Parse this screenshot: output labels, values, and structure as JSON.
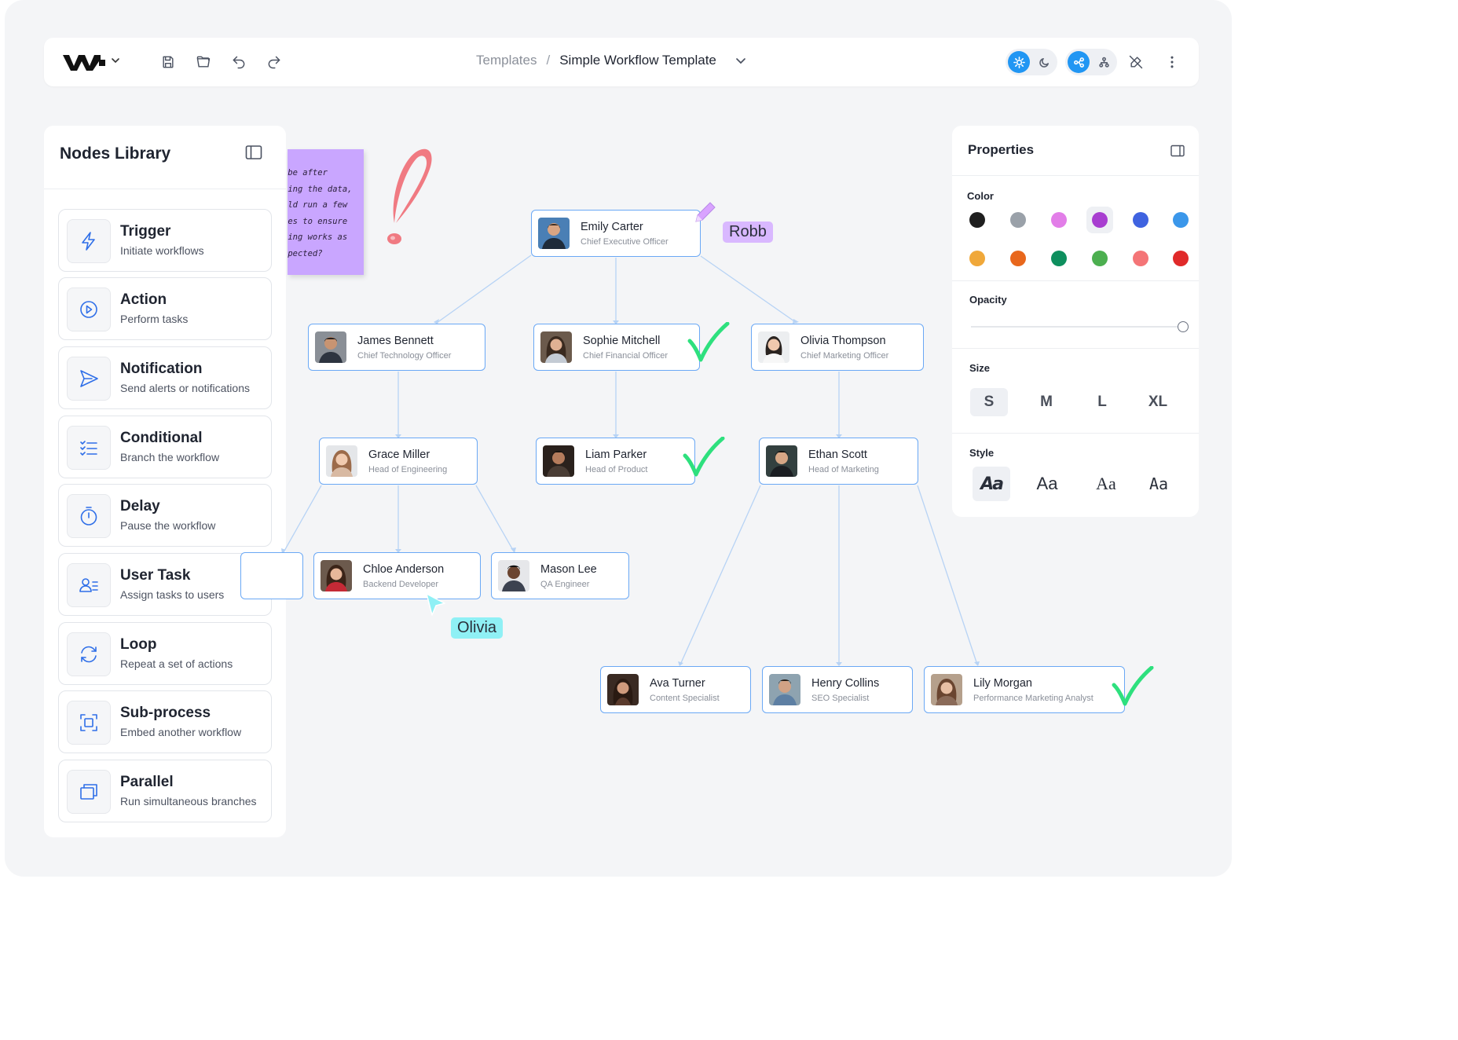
{
  "header": {
    "breadcrumb_parent": "Templates",
    "breadcrumb_separator": "/",
    "breadcrumb_current": "Simple Workflow Template",
    "toolbar_icons": [
      "save-icon",
      "folder-open-icon",
      "undo-icon",
      "redo-icon"
    ],
    "right_icons": [
      "sun-icon",
      "moon-icon",
      "workflow-view-icon",
      "hierarchy-view-icon",
      "edit-off-icon",
      "more-vertical-icon"
    ],
    "accent_color": "#2196f3"
  },
  "nodes_library": {
    "title": "Nodes Library",
    "items": [
      {
        "title": "Trigger",
        "subtitle": "Initiate workflows",
        "icon": "lightning-icon"
      },
      {
        "title": "Action",
        "subtitle": "Perform tasks",
        "icon": "play-circle-icon"
      },
      {
        "title": "Notification",
        "subtitle": "Send alerts or notifications",
        "icon": "send-icon"
      },
      {
        "title": "Conditional",
        "subtitle": "Branch the workflow",
        "icon": "checklist-icon"
      },
      {
        "title": "Delay",
        "subtitle": "Pause the workflow",
        "icon": "timer-icon"
      },
      {
        "title": "User Task",
        "subtitle": "Assign tasks to users",
        "icon": "user-list-icon"
      },
      {
        "title": "Loop",
        "subtitle": "Repeat a set of actions",
        "icon": "loop-icon"
      },
      {
        "title": "Sub-process",
        "subtitle": "Embed another workflow",
        "icon": "subprocess-icon"
      },
      {
        "title": "Parallel",
        "subtitle": "Run simultaneous branches",
        "icon": "parallel-icon"
      }
    ]
  },
  "canvas": {
    "sticky_note_lines": [
      "ybe after",
      "sing the data,",
      "uld run a few",
      "ses to ensure",
      "hing works as",
      "xpected?"
    ],
    "sticky_color": "#c9a6ff",
    "cursor_labels": {
      "robb": "Robb",
      "olivia": "Olivia"
    },
    "people": [
      {
        "name": "Emily Carter",
        "role": "Chief Executive Officer"
      },
      {
        "name": "James Bennett",
        "role": "Chief Technology Officer"
      },
      {
        "name": "Sophie Mitchell",
        "role": "Chief Financial Officer"
      },
      {
        "name": "Olivia Thompson",
        "role": "Chief Marketing Officer"
      },
      {
        "name": "Grace Miller",
        "role": "Head of Engineering"
      },
      {
        "name": "Liam Parker",
        "role": "Head of Product"
      },
      {
        "name": "Ethan Scott",
        "role": "Head of Marketing"
      },
      {
        "name": "Chloe Anderson",
        "role": "Backend Developer"
      },
      {
        "name": "Mason Lee",
        "role": "QA Engineer"
      },
      {
        "name": "Ava Turner",
        "role": "Content Specialist"
      },
      {
        "name": "Henry Collins",
        "role": "SEO Specialist"
      },
      {
        "name": "Lily Morgan",
        "role": "Performance Marketing Analyst"
      }
    ],
    "connector_color": "#b7d3f5",
    "node_border_color": "#6aa8f5",
    "check_color": "#2ee07e"
  },
  "properties": {
    "title": "Properties",
    "color_label": "Color",
    "colors": [
      "#1f1f1f",
      "#9aa1a9",
      "#e27ee8",
      "#a83ed0",
      "#3f63e0",
      "#3b97ea",
      "#f0a83a",
      "#e8671c",
      "#0e8f5e",
      "#4caf50",
      "#f47577",
      "#e02a2a"
    ],
    "selected_color": "#a83ed0",
    "opacity_label": "Opacity",
    "opacity": 1,
    "size_label": "Size",
    "sizes": [
      "S",
      "M",
      "L",
      "XL"
    ],
    "selected_size": "S",
    "style_label": "Style",
    "styles": [
      "Aa",
      "Aa",
      "Aa",
      "Aa"
    ]
  }
}
